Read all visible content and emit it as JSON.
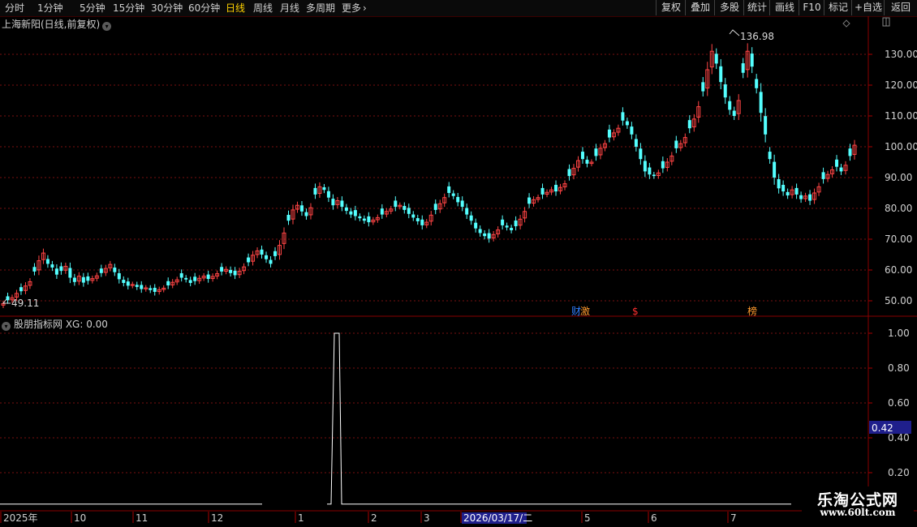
{
  "toolbar": {
    "periods": [
      "分时",
      "1分钟",
      "5分钟",
      "15分钟",
      "30分钟",
      "60分钟",
      "日线",
      "周线",
      "月线",
      "多周期",
      "更多"
    ],
    "active_period": "日线",
    "more_arrow": "›",
    "right_buttons": [
      "复权",
      "叠加",
      "多股",
      "统计",
      "画线",
      "F10",
      "标记",
      "+自选",
      "返回"
    ]
  },
  "main": {
    "title": "上海新阳(日线,前复权)",
    "high_label": "136.98",
    "low_label": "49.11",
    "price_ticks": [
      "130.00",
      "120.00",
      "110.00",
      "100.00",
      "90.00",
      "80.00",
      "70.00",
      "60.00",
      "50.00"
    ],
    "markers": [
      {
        "text": "财",
        "color": "#2f7fff"
      },
      {
        "text": "激",
        "color": "#ff9a2e"
      },
      {
        "text": "$",
        "color": "#ff3030"
      },
      {
        "text": "榜",
        "color": "#ff9a2e"
      }
    ]
  },
  "indicator": {
    "title": "股朋指标网 XG: 0.00",
    "ticks": [
      "1.00",
      "0.80",
      "0.60",
      "0.40",
      "0.20"
    ],
    "cursor_value": "0.42"
  },
  "date_axis": {
    "labels": [
      "2025年",
      "10",
      "11",
      "12",
      "1",
      "2",
      "3",
      "2026/03/17/二",
      "5",
      "6",
      "7"
    ]
  },
  "watermark": {
    "line1": "乐淘公式网",
    "line2": "www.60lt.com"
  },
  "colors": {
    "up": "#ff4444",
    "down": "#54ffff",
    "grid": "#7a1010",
    "active_tab": "#ffd200",
    "cursor_box": "#1f1f8c"
  },
  "chart_data": {
    "type": "candlestick",
    "ylim": [
      45,
      140
    ],
    "high": 136.98,
    "low": 49.11,
    "close_path": [
      49.1,
      50.2,
      51.0,
      52.4,
      53.1,
      54.8,
      56.2,
      59.5,
      63.0,
      65.5,
      62.0,
      60.8,
      58.5,
      59.7,
      61.2,
      57.5,
      56.1,
      58.0,
      55.9,
      56.5,
      57.2,
      58.1,
      59.0,
      60.5,
      61.8,
      59.3,
      57.0,
      55.8,
      54.9,
      55.3,
      54.5,
      53.8,
      54.2,
      53.5,
      52.9,
      53.6,
      54.1,
      55.0,
      56.0,
      56.8,
      57.5,
      56.9,
      55.8,
      56.4,
      57.3,
      58.0,
      57.1,
      57.9,
      58.8,
      59.5,
      60.2,
      59.0,
      58.3,
      59.6,
      61.0,
      62.5,
      64.8,
      66.2,
      65.0,
      63.5,
      62.0,
      64.5,
      68.0,
      72.0,
      76.0,
      79.5,
      81.0,
      79.0,
      77.5,
      80.2,
      84.5,
      87.0,
      86.0,
      83.5,
      81.0,
      82.5,
      80.5,
      79.2,
      78.0,
      77.5,
      76.8,
      76.0,
      75.5,
      76.2,
      77.0,
      78.0,
      79.0,
      79.8,
      80.5,
      81.0,
      79.5,
      78.2,
      77.0,
      75.8,
      74.5,
      75.5,
      77.8,
      79.5,
      81.5,
      83.5,
      85.0,
      84.0,
      82.0,
      80.5,
      78.0,
      76.0,
      73.5,
      72.0,
      71.0,
      70.2,
      71.5,
      73.0,
      74.5,
      73.8,
      72.9,
      74.2,
      76.5,
      79.0,
      81.5,
      82.8,
      83.5,
      84.5,
      85.2,
      86.0,
      85.5,
      86.8,
      88.0,
      90.5,
      93.0,
      95.5,
      96.0,
      94.5,
      95.0,
      97.0,
      99.5,
      101.0,
      103.0,
      104.5,
      106.0,
      108.5,
      107.0,
      104.0,
      100.0,
      96.0,
      92.0,
      91.0,
      90.5,
      91.5,
      93.0,
      95.0,
      97.0,
      99.5,
      101.0,
      103.0,
      106.0,
      109.0,
      113.0,
      118.0,
      125.0,
      131.0,
      127.0,
      121.0,
      116.0,
      112.0,
      110.0,
      115.0,
      124.0,
      131.0,
      126.0,
      119.0,
      111.0,
      104.0,
      96.0,
      90.0,
      86.5,
      85.5,
      84.2,
      86.0,
      84.5,
      83.0,
      84.0,
      82.5,
      85.0,
      87.0,
      89.5,
      91.0,
      92.5,
      93.5,
      92.0,
      94.0,
      97.0,
      100.5
    ],
    "xg_signal": {
      "type": "line",
      "values_note_index": 76,
      "max": 1.0
    }
  }
}
